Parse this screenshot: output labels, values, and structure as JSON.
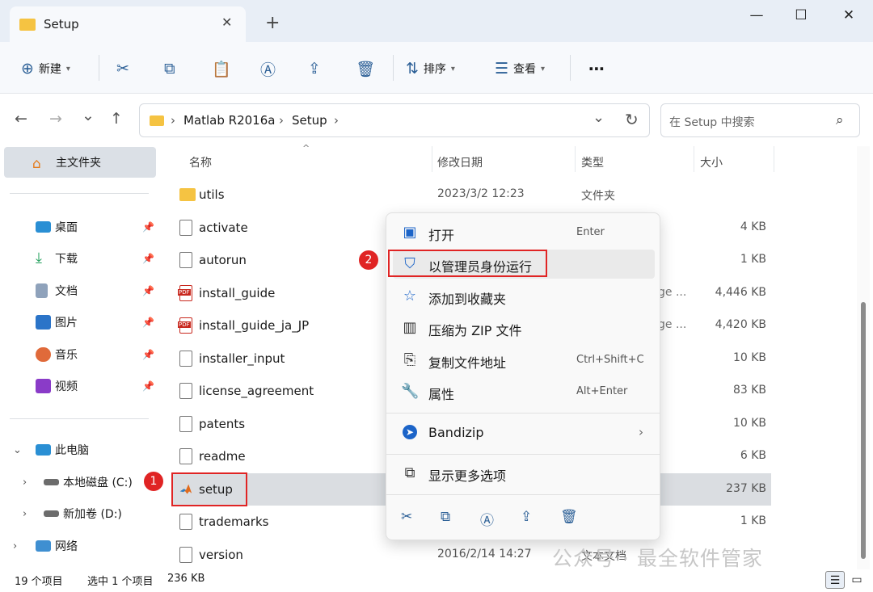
{
  "window": {
    "tab_title": "Setup",
    "close_tab": "✕",
    "new_tab": "+",
    "minimize": "—",
    "maximize": "☐",
    "close": "✕"
  },
  "toolbar": {
    "new_label": "新建",
    "sort_label": "排序",
    "view_label": "查看",
    "more": "⋯"
  },
  "nav": {
    "back": "←",
    "forward": "→",
    "recent": "⌄",
    "up": "↑",
    "breadcrumb": [
      "Matlab R2016a",
      "Setup"
    ],
    "sep": "›",
    "refresh": "↻",
    "dropdown": "⌄"
  },
  "search": {
    "placeholder": "在 Setup 中搜索",
    "icon": "⌕"
  },
  "sidebar": {
    "home": "主文件夹",
    "quick": [
      {
        "label": "桌面",
        "icon": "desktop-icon",
        "color": "#2a8fd4"
      },
      {
        "label": "下载",
        "icon": "download-icon",
        "color": "#1f9e5a"
      },
      {
        "label": "文档",
        "icon": "document-icon",
        "color": "#6b84a3"
      },
      {
        "label": "图片",
        "icon": "picture-icon",
        "color": "#2b74c8"
      },
      {
        "label": "音乐",
        "icon": "music-icon",
        "color": "#e06a3a"
      },
      {
        "label": "视频",
        "icon": "video-icon",
        "color": "#8a3bc8"
      }
    ],
    "pc": "此电脑",
    "drives": [
      "本地磁盘 (C:)",
      "新加卷 (D:)"
    ],
    "network": "网络"
  },
  "columns": {
    "name": "名称",
    "date": "修改日期",
    "type": "类型",
    "size": "大小"
  },
  "files": [
    {
      "name": "utils",
      "date": "2023/3/2 12:23",
      "type": "文件夹",
      "size": "",
      "icon": "folder"
    },
    {
      "name": "activate",
      "date": "",
      "type": "",
      "size": "4 KB",
      "icon": "file"
    },
    {
      "name": "autorun",
      "date": "",
      "type": "",
      "size": "1 KB",
      "icon": "file"
    },
    {
      "name": "install_guide",
      "date": "",
      "type": "",
      "size": "4,446 KB",
      "icon": "pdf",
      "partial": "ge ..."
    },
    {
      "name": "install_guide_ja_JP",
      "date": "",
      "type": "",
      "size": "4,420 KB",
      "icon": "pdf",
      "partial": "ge ..."
    },
    {
      "name": "installer_input",
      "date": "",
      "type": "",
      "size": "10 KB",
      "icon": "file"
    },
    {
      "name": "license_agreement",
      "date": "",
      "type": "",
      "size": "83 KB",
      "icon": "file"
    },
    {
      "name": "patents",
      "date": "",
      "type": "",
      "size": "10 KB",
      "icon": "file"
    },
    {
      "name": "readme",
      "date": "",
      "type": "",
      "size": "6 KB",
      "icon": "file"
    },
    {
      "name": "setup",
      "date": "",
      "type": "",
      "size": "237 KB",
      "icon": "setup",
      "selected": true
    },
    {
      "name": "trademarks",
      "date": "",
      "type": "",
      "size": "1 KB",
      "icon": "file"
    },
    {
      "name": "version",
      "date": "2016/2/14 14:27",
      "type": "文本文档",
      "size": "",
      "icon": "file"
    }
  ],
  "context_menu": {
    "items": [
      {
        "label": "打开",
        "shortcut": "Enter",
        "icon": "open-icon"
      },
      {
        "label": "以管理员身份运行",
        "shortcut": "",
        "icon": "shield-icon"
      },
      {
        "label": "添加到收藏夹",
        "shortcut": "",
        "icon": "star-icon"
      },
      {
        "label": "压缩为 ZIP 文件",
        "shortcut": "",
        "icon": "zip-icon"
      },
      {
        "label": "复制文件地址",
        "shortcut": "Ctrl+Shift+C",
        "icon": "copy-path-icon"
      },
      {
        "label": "属性",
        "shortcut": "Alt+Enter",
        "icon": "wrench-icon"
      }
    ],
    "bandizip": "Bandizip",
    "more": "显示更多选项"
  },
  "annotations": {
    "badge1": "1",
    "badge2": "2"
  },
  "status": {
    "count": "19 个项目",
    "selected": "选中 1 个项目",
    "size": "236 KB"
  },
  "watermark": "公众号 · 最全软件管家"
}
